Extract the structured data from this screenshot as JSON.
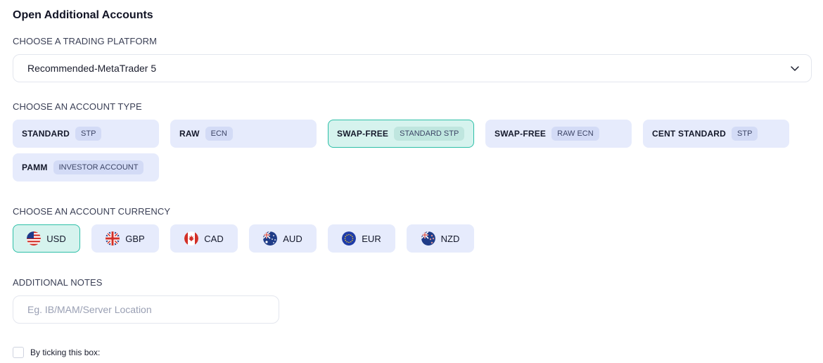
{
  "heading": "Open Additional Accounts",
  "platform": {
    "label": "CHOOSE A TRADING PLATFORM",
    "selected": "Recommended-MetaTrader 5"
  },
  "account_type": {
    "label": "CHOOSE AN ACCOUNT TYPE",
    "options": [
      {
        "name": "STANDARD",
        "tag": "STP",
        "selected": false
      },
      {
        "name": "RAW",
        "tag": "ECN",
        "selected": false
      },
      {
        "name": "SWAP-FREE",
        "tag": "STANDARD STP",
        "selected": true
      },
      {
        "name": "SWAP-FREE",
        "tag": "RAW ECN",
        "selected": false
      },
      {
        "name": "CENT STANDARD",
        "tag": "STP",
        "selected": false
      },
      {
        "name": "PAMM",
        "tag": "INVESTOR ACCOUNT",
        "selected": false
      }
    ]
  },
  "currency": {
    "label": "CHOOSE AN ACCOUNT CURRENCY",
    "options": [
      {
        "code": "USD",
        "flag_icon": "us-flag-icon",
        "selected": true
      },
      {
        "code": "GBP",
        "flag_icon": "uk-flag-icon",
        "selected": false
      },
      {
        "code": "CAD",
        "flag_icon": "canada-flag-icon",
        "selected": false
      },
      {
        "code": "AUD",
        "flag_icon": "australia-flag-icon",
        "selected": false
      },
      {
        "code": "EUR",
        "flag_icon": "eu-flag-icon",
        "selected": false
      },
      {
        "code": "NZD",
        "flag_icon": "new-zealand-flag-icon",
        "selected": false
      }
    ]
  },
  "notes": {
    "label": "ADDITIONAL NOTES",
    "placeholder": "Eg. IB/MAM/Server Location",
    "value": ""
  },
  "consent": {
    "label": "By ticking this box:",
    "checked": false
  },
  "colors": {
    "option_bg": "#e6ebfc",
    "selected_bg": "#d6f3ee",
    "selected_border": "#2dbfa7"
  }
}
